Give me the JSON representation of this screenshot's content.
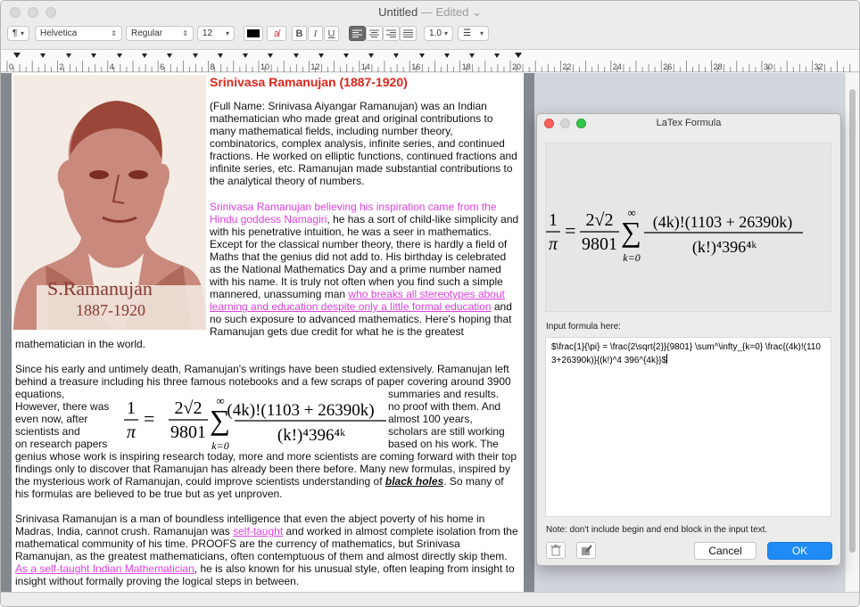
{
  "window": {
    "title": "Untitled",
    "status": "— Edited"
  },
  "toolbar": {
    "paragraph_label": "¶",
    "font_family": "Helvetica",
    "font_style": "Regular",
    "font_size": "12",
    "bold_label": "B",
    "italic_label": "I",
    "underline_label": "U",
    "line_spacing": "1.0",
    "text_color": "#000000"
  },
  "ruler": {
    "ticks": [
      "0",
      "2",
      "4",
      "6",
      "8",
      "10",
      "12",
      "14",
      "16",
      "18",
      "20",
      "22",
      "24",
      "26",
      "28",
      "30",
      "32"
    ]
  },
  "document": {
    "portrait_caption_name": "S.Ramanujan",
    "portrait_caption_years": "1887-1920",
    "heading": "Srinivasa Ramanujan (1887-1920)",
    "p1": " (Full Name: Srinivasa Aiyangar Ramanujan) was an Indian mathematician who made great and original contributions to many mathematical fields, including number theory, combinatorics, complex analysis, infinite series, and continued fractions. He worked on elliptic functions, continued fractions and infinite series, etc. Ramanujan made substantial contributions to the analytical theory of numbers.",
    "p2_pink": "Srinivasa Ramanujan believing his inspiration came from the Hindu goddess Namagiri",
    "p2_text": ", he has a sort of child-like simplicity and with his penetrative intuition, he was a seer in mathematics. Except for the classical number theory, there is hardly a field of Maths that the genius did not add to. His birthday is celebrated as the National Mathematics Day and a prime number named with his name. It is truly not often when you find such a simple mannered, unassuming man ",
    "p2_link": "who breaks all stereotypes about learning and education despite only a little formal education",
    "p2_end": " and no such exposure to advanced mathematics. Here's hoping that Ramanujan gets due credit for what he is the greatest",
    "p2_tail": "mathematician in the world.",
    "p3_start": "Since his early and untimely death, Ramanujan's writings have been studied extensively. Ramanujan left behind a treasure including his three famous notebooks and a few scraps of paper covering around 3900 equations,",
    "p3_left1": "However, there was",
    "p3_left2": "even now, after",
    "p3_left3": "scientists and",
    "p3_left4": "on research papers",
    "p3_right0": "summaries and results.",
    "p3_right1": "no proof with them. And",
    "p3_right2": "almost 100 years,",
    "p3_right3": "scholars are still working",
    "p3_right4": "based on his work. The",
    "p3_end": "genius whose work is inspiring research today, more and more scientists are coming forward with their top findings only to discover that Ramanujan has already been there before. Many new formulas, inspired by the mysterious work of Ramanujan, could improve scientists understanding of ",
    "p3_bold": "black holes",
    "p3_final": ". So many of his formulas are believed to be true but as yet unproven.",
    "p4_start": "Srinivasa Ramanujan is a man of boundless intelligence that even the abject poverty of his home in Madras, India, cannot crush. Ramanujan was ",
    "p4_link1": "self-taught",
    "p4_mid": " and worked in almost complete isolation from the mathematical community of his time. PROOFS are the currency of mathematics, but Srinivasa Ramanujan, as the greatest mathematicians, often contemptuous of them and almost directly skip them. ",
    "p4_link2": "As a self-taught Indian Mathematician",
    "p4_end": ", he is also known for his unusual style, often leaping from insight to insight without formally proving the logical steps in between."
  },
  "formula": {
    "lhs_num": "1",
    "lhs_den": "π",
    "eq": "=",
    "coef_num": "2√2",
    "coef_den": "9801",
    "sigma": "∑",
    "sum_upper": "∞",
    "sum_lower": "k=0",
    "frac_num": "(4k)!(1103 + 26390k)",
    "frac_den": "(k!)⁴396⁴ᵏ"
  },
  "dialog": {
    "title": "LaTex Formula",
    "input_label": "Input formula here:",
    "input_value": "$\\frac{1}{\\pi} = \\frac{2\\sqrt{2}}{9801} \\sum^\\infty_{k=0} \\frac{(4k)!(1103+26390k)}{(k!)^4 396^{4k}}$",
    "note": "Note: don't include begin and end block in the input text.",
    "cancel_label": "Cancel",
    "ok_label": "OK"
  }
}
